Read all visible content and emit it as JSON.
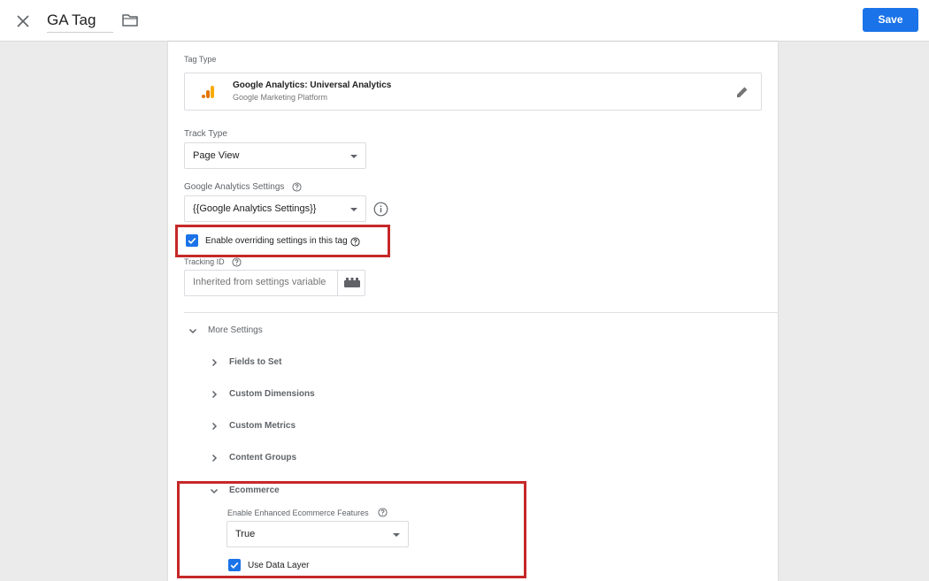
{
  "header": {
    "close_icon": "close-icon",
    "tag_name": "GA Tag",
    "folder_icon": "folder-icon",
    "save_label": "Save"
  },
  "tag_type": {
    "label": "Tag Type",
    "name": "Google Analytics: Universal Analytics",
    "subtitle": "Google Marketing Platform",
    "logo_icon": "google-analytics-logo",
    "edit_icon": "pencil-icon"
  },
  "track_type": {
    "label": "Track Type",
    "value": "Page View"
  },
  "ga_settings": {
    "label": "Google Analytics Settings",
    "value": "{{Google Analytics Settings}}",
    "info_icon": "info-icon"
  },
  "override": {
    "label": "Enable overriding settings in this tag",
    "checked": true
  },
  "tracking_id": {
    "label": "Tracking ID",
    "placeholder": "Inherited from settings variable",
    "variable_icon": "variable-picker-icon"
  },
  "more_settings": {
    "label": "More Settings",
    "expanded": true,
    "sections": [
      {
        "label": "Fields to Set",
        "expanded": false
      },
      {
        "label": "Custom Dimensions",
        "expanded": false
      },
      {
        "label": "Custom Metrics",
        "expanded": false
      },
      {
        "label": "Content Groups",
        "expanded": false
      },
      {
        "label": "Ecommerce",
        "expanded": true
      }
    ]
  },
  "ecommerce": {
    "enhanced_label": "Enable Enhanced Ecommerce Features",
    "enhanced_value": "True",
    "data_layer_label": "Use Data Layer",
    "data_layer_checked": true
  },
  "colors": {
    "accent": "#1a73e8",
    "highlight": "#c62828",
    "ga_orange": "#f9ab00",
    "ga_dark_orange": "#e37400"
  }
}
